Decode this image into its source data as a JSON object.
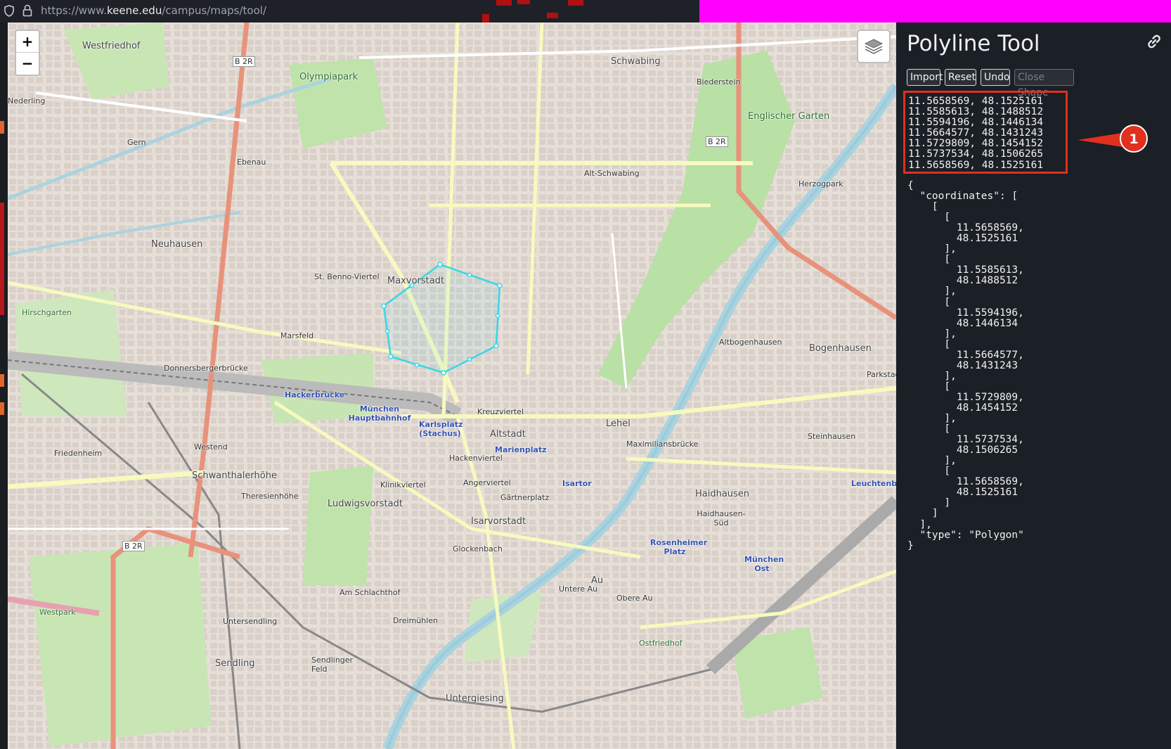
{
  "browser": {
    "url_prefix": "https://www.",
    "url_domain": "keene.edu",
    "url_path": "/campus/maps/tool/"
  },
  "map": {
    "zoom_in_label": "+",
    "zoom_out_label": "−",
    "labels": [
      "Westfriedhof",
      "Olympiapark",
      "Schwabing",
      "Biederstein",
      "Englischer Garten",
      "Gern",
      "Ebenau",
      "Alt-Schwabing",
      "Herzogpark",
      "Neuhausen",
      "St. Benno-Viertel",
      "Maxvorstadt",
      "Marsfeld",
      "Donnersbergerbrücke",
      "Hackerbrücke",
      "München Hauptbahnhof",
      "Karlsplatz (Stachus)",
      "Altstadt",
      "Marienplatz",
      "Kreuzviertel",
      "Lehel",
      "Bogenhausen",
      "Altbogenhausen",
      "Friedenheim",
      "Westend",
      "Schwanthalerhöhe",
      "Theresienhöhe",
      "Ludwigsvorstadt",
      "Klinikviertel",
      "Hackenviertel",
      "Angerviertel",
      "Isartor",
      "Haidhausen",
      "Gärtnerplatz",
      "Isarvorstadt",
      "Glockenbach",
      "Am Schlachthof",
      "Untere Au",
      "Obere Au",
      "Au",
      "Westpark",
      "Untersendling",
      "Dreimühlen",
      "Sendling",
      "Sendlinger Feld",
      "Untergiesing",
      "Ostfriedhof",
      "München Ost",
      "Steinhausen",
      "Hirschgarten",
      "Nederling",
      "Rosenheimer Platz",
      "Haidhausen-Süd",
      "Maximiliansbrücke",
      "B 2R",
      "Leuchtenberg",
      "Parkstadt"
    ]
  },
  "panel": {
    "title": "Polyline Tool",
    "buttons": {
      "import": "Import",
      "reset": "Reset",
      "undo": "Undo",
      "close_shape": "Close Shape"
    },
    "coordinate_lines": [
      "11.5658569, 48.1525161",
      "11.5585613, 48.1488512",
      "11.5594196, 48.1446134",
      "11.5664577, 48.1431243",
      "11.5729809, 48.1454152",
      "11.5737534, 48.1506265",
      "11.5658569, 48.1525161"
    ],
    "geojson_text": "{\n  \"coordinates\": [\n    [\n      [\n        11.5658569,\n        48.1525161\n      ],\n      [\n        11.5585613,\n        48.1488512\n      ],\n      [\n        11.5594196,\n        48.1446134\n      ],\n      [\n        11.5664577,\n        48.1431243\n      ],\n      [\n        11.5729809,\n        48.1454152\n      ],\n      [\n        11.5737534,\n        48.1506265\n      ],\n      [\n        11.5658569,\n        48.1525161\n      ]\n    ]\n  ],\n  \"type\": \"Polygon\"\n}"
  },
  "annotation": {
    "callout_number": "1",
    "color": "#e0301e"
  },
  "colors": {
    "polygon": "#37d6e8",
    "panel_bg": "#1b1f26",
    "map_bg": "#f2efe9",
    "highlight_box": "#e0301e"
  },
  "icons": [
    "shield-icon",
    "lock-icon",
    "layers-icon",
    "link-icon"
  ]
}
